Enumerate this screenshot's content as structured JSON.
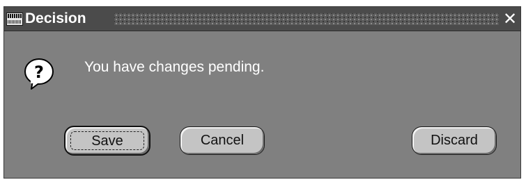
{
  "window": {
    "title": "Decision",
    "close_glyph": "✕"
  },
  "dialog": {
    "icon": "question-mark-icon",
    "message": "You have changes pending."
  },
  "buttons": {
    "save_label": "Save",
    "cancel_label": "Cancel",
    "discard_label": "Discard"
  },
  "colors": {
    "dialog_background": "#808080",
    "titlebar_background": "#4b4b4b",
    "button_face": "#c4c4c4"
  }
}
